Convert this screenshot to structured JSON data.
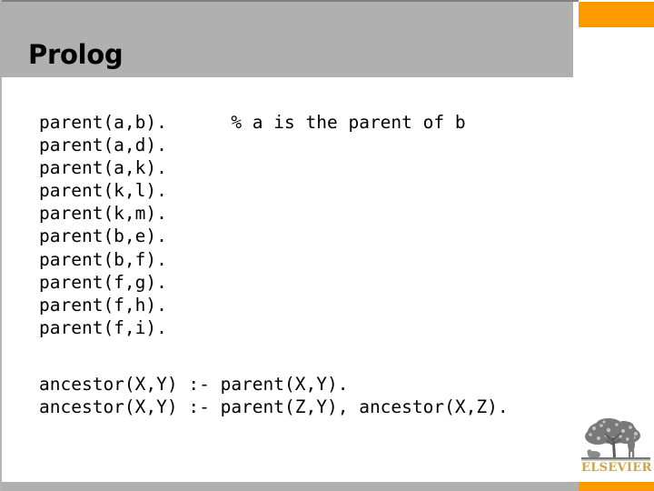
{
  "slide": {
    "title": "Prolog",
    "accent_color": "#ff9900",
    "banner_color": "#b0b0b0",
    "background_color": "#ffffff",
    "text_color": "#000000"
  },
  "code": {
    "facts_block": "parent(a,b).      % a is the parent of b\nparent(a,d).\nparent(a,k).\nparent(k,l).\nparent(k,m).\nparent(b,e).\nparent(b,f).\nparent(f,g).\nparent(f,h).\nparent(f,i).",
    "rules_block": "ancestor(X,Y) :- parent(X,Y).\nancestor(X,Y) :- parent(Z,Y), ancestor(X,Z).",
    "facts": [
      "parent(a,b).",
      "parent(a,d).",
      "parent(a,k).",
      "parent(k,l).",
      "parent(k,m).",
      "parent(b,e).",
      "parent(b,f).",
      "parent(f,g).",
      "parent(f,h).",
      "parent(f,i)."
    ],
    "comment": "% a is the parent of b",
    "rules": [
      "ancestor(X,Y) :- parent(X,Y).",
      "ancestor(X,Y) :- parent(Z,Y), ancestor(X,Z)."
    ]
  },
  "logo": {
    "wordmark": "ELSEVIER",
    "wordmark_color": "#c8a44a",
    "mark_name": "elsevier-tree-emblem"
  }
}
